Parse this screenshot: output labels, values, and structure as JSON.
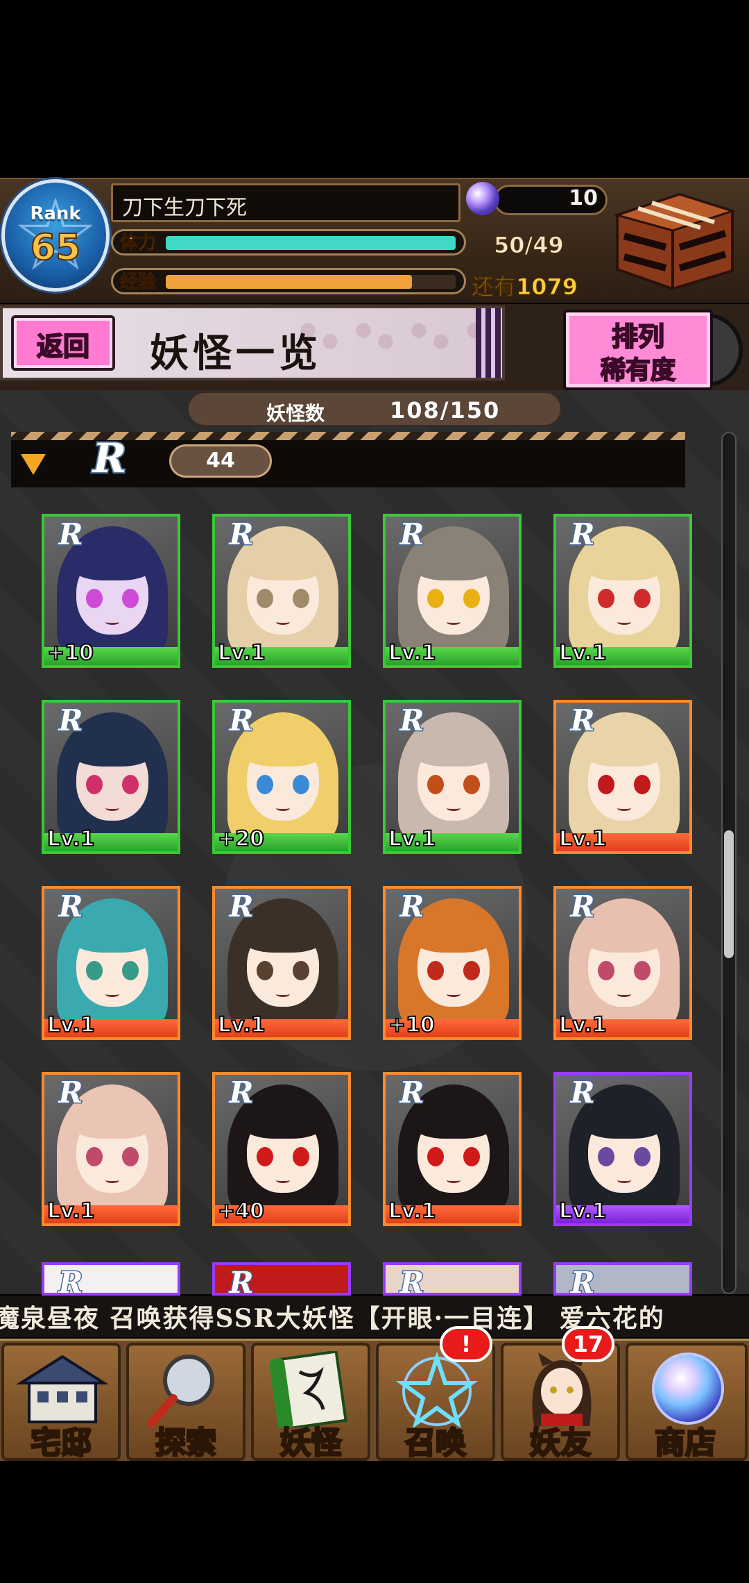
{
  "header": {
    "rank_label": "Rank",
    "rank_value": "65",
    "player_name": "刀下生刀下死",
    "gem_count": "10",
    "stamina_label": "体力",
    "stamina_value": "50/49",
    "stamina_fraction": 1.0,
    "exp_label": "经验",
    "exp_remaining": "还有1079",
    "exp_fraction": 0.85,
    "stamina_color": "#3fd9c5",
    "exp_color": "#f0a23a"
  },
  "title_bar": {
    "back_label": "返回",
    "page_title": "妖怪一览",
    "sort_label": "排列",
    "sort_value": "稀有度"
  },
  "counter": {
    "label": "妖怪数",
    "value": "108/150"
  },
  "filter": {
    "rarity_icon": "r-rarity-icon",
    "count": "44"
  },
  "cards": [
    {
      "lv": "+10",
      "frame": "green",
      "hair": "#2a2c6a",
      "eyes": "#d04ad8",
      "skin": "#e8d6f2"
    },
    {
      "lv": "Lv.1",
      "frame": "green",
      "hair": "#e4cfa8",
      "eyes": "#a08a6a",
      "skin": "#fbe9dc"
    },
    {
      "lv": "Lv.1",
      "frame": "green",
      "hair": "#8a8276",
      "eyes": "#e8b010",
      "skin": "#fbe9dc"
    },
    {
      "lv": "Lv.1",
      "frame": "green",
      "hair": "#e8d49a",
      "eyes": "#d02a2a",
      "skin": "#fbe9dc"
    },
    {
      "lv": "Lv.1",
      "frame": "green",
      "hair": "#223050",
      "eyes": "#d0306a",
      "skin": "#f4dcd6"
    },
    {
      "lv": "+20",
      "frame": "green",
      "hair": "#f0cf6a",
      "eyes": "#3a8ad8",
      "skin": "#fbe9dc"
    },
    {
      "lv": "Lv.1",
      "frame": "green",
      "hair": "#c9b8ae",
      "eyes": "#c0501a",
      "skin": "#fbe9dc"
    },
    {
      "lv": "Lv.1",
      "frame": "orange",
      "hair": "#e8d4a8",
      "eyes": "#c01a1a",
      "skin": "#fbe9dc"
    },
    {
      "lv": "Lv.1",
      "frame": "orange",
      "hair": "#3aaab0",
      "eyes": "#3a9a8a",
      "skin": "#fbe9dc"
    },
    {
      "lv": "Lv.1",
      "frame": "orange",
      "hair": "#3a3028",
      "eyes": "#5a4030",
      "skin": "#fbe9dc"
    },
    {
      "lv": "+10",
      "frame": "orange",
      "hair": "#d8762a",
      "eyes": "#c02a1a",
      "skin": "#fbe9dc"
    },
    {
      "lv": "Lv.1",
      "frame": "orange",
      "hair": "#e8c0b0",
      "eyes": "#c04a6a",
      "skin": "#fbe9dc"
    },
    {
      "lv": "Lv.1",
      "frame": "orange",
      "hair": "#eac4b4",
      "eyes": "#c04a6a",
      "skin": "#fbe9dc"
    },
    {
      "lv": "+40",
      "frame": "orange",
      "hair": "#1c1616",
      "eyes": "#d01a1a",
      "skin": "#fbe9dc"
    },
    {
      "lv": "Lv.1",
      "frame": "orange",
      "hair": "#1c1616",
      "eyes": "#d01a1a",
      "skin": "#fbe9dc"
    },
    {
      "lv": "Lv.1",
      "frame": "purple",
      "hair": "#1e2228",
      "eyes": "#6a4aa0",
      "skin": "#fbe9dc"
    }
  ],
  "partial_cards": [
    {
      "frame": "purple",
      "hair": "#f2f0f2"
    },
    {
      "frame": "purple",
      "hair": "#c01a1a"
    },
    {
      "frame": "purple",
      "hair": "#e8d4c8"
    },
    {
      "frame": "purple",
      "hair": "#b0b8c8"
    }
  ],
  "ticker_text": "魔泉昼夜 召唤获得SSR大妖怪【开眼·一目连】  爱六花的",
  "nav": [
    {
      "label": "宅邸",
      "icon": "mansion-icon"
    },
    {
      "label": "探索",
      "icon": "magnifier-icon"
    },
    {
      "label": "妖怪",
      "icon": "scroll-icon"
    },
    {
      "label": "召唤",
      "icon": "pentagram-icon",
      "badge": "!"
    },
    {
      "label": "妖友",
      "icon": "friend-icon",
      "badge": "17"
    },
    {
      "label": "商店",
      "icon": "orb-icon"
    }
  ]
}
